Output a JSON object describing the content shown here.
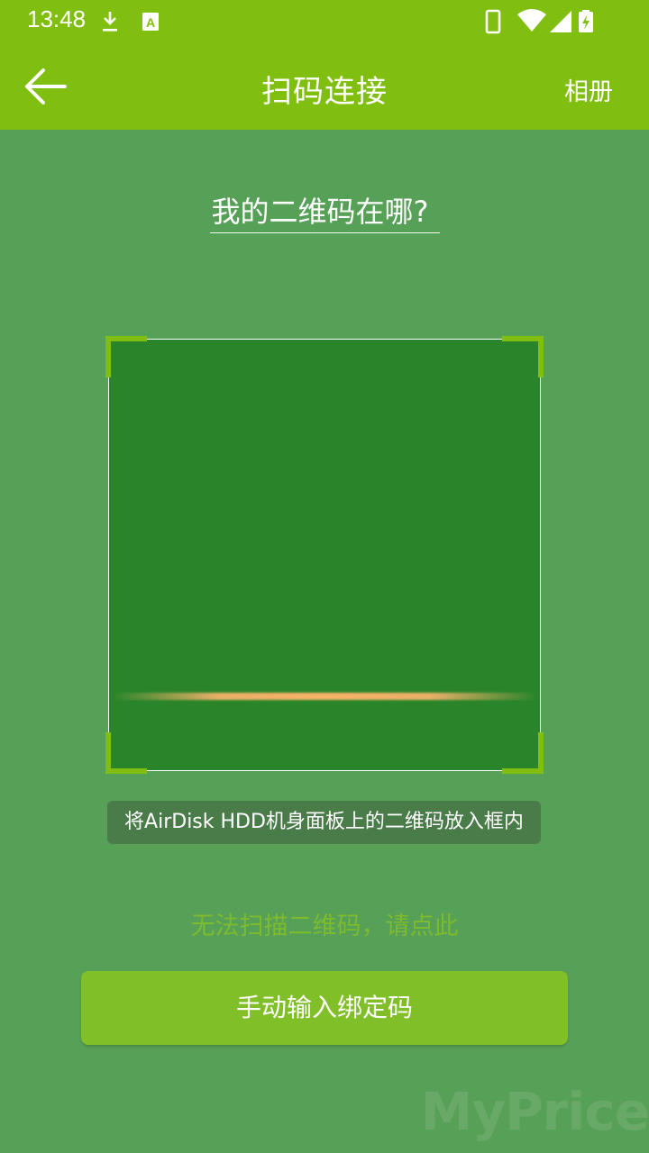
{
  "status_bar": {
    "time": "13:48",
    "left_icons": [
      "download-icon",
      "a-box-icon"
    ],
    "right_icons": [
      "phone-icon",
      "wifi-icon",
      "cell-signal-icon",
      "battery-charging-icon"
    ]
  },
  "app_bar": {
    "title": "扫码连接",
    "back_icon": "arrow-left-icon",
    "album_label": "相册"
  },
  "help_link": "我的二维码在哪?",
  "scanner": {
    "hint": "将AirDisk HDD机身面板上的二维码放入框内",
    "frame_color": "#2a852a",
    "corner_color": "#80bf10",
    "scan_line_color": "#f7b268"
  },
  "cant_scan_link": "无法扫描二维码，请点此",
  "manual_button_label": "手动输入绑定码",
  "watermark": "MyPrice",
  "colors": {
    "primary": "#80bf10",
    "background": "#57a057",
    "button": "#80bf28",
    "link": "#7dbb2e"
  }
}
